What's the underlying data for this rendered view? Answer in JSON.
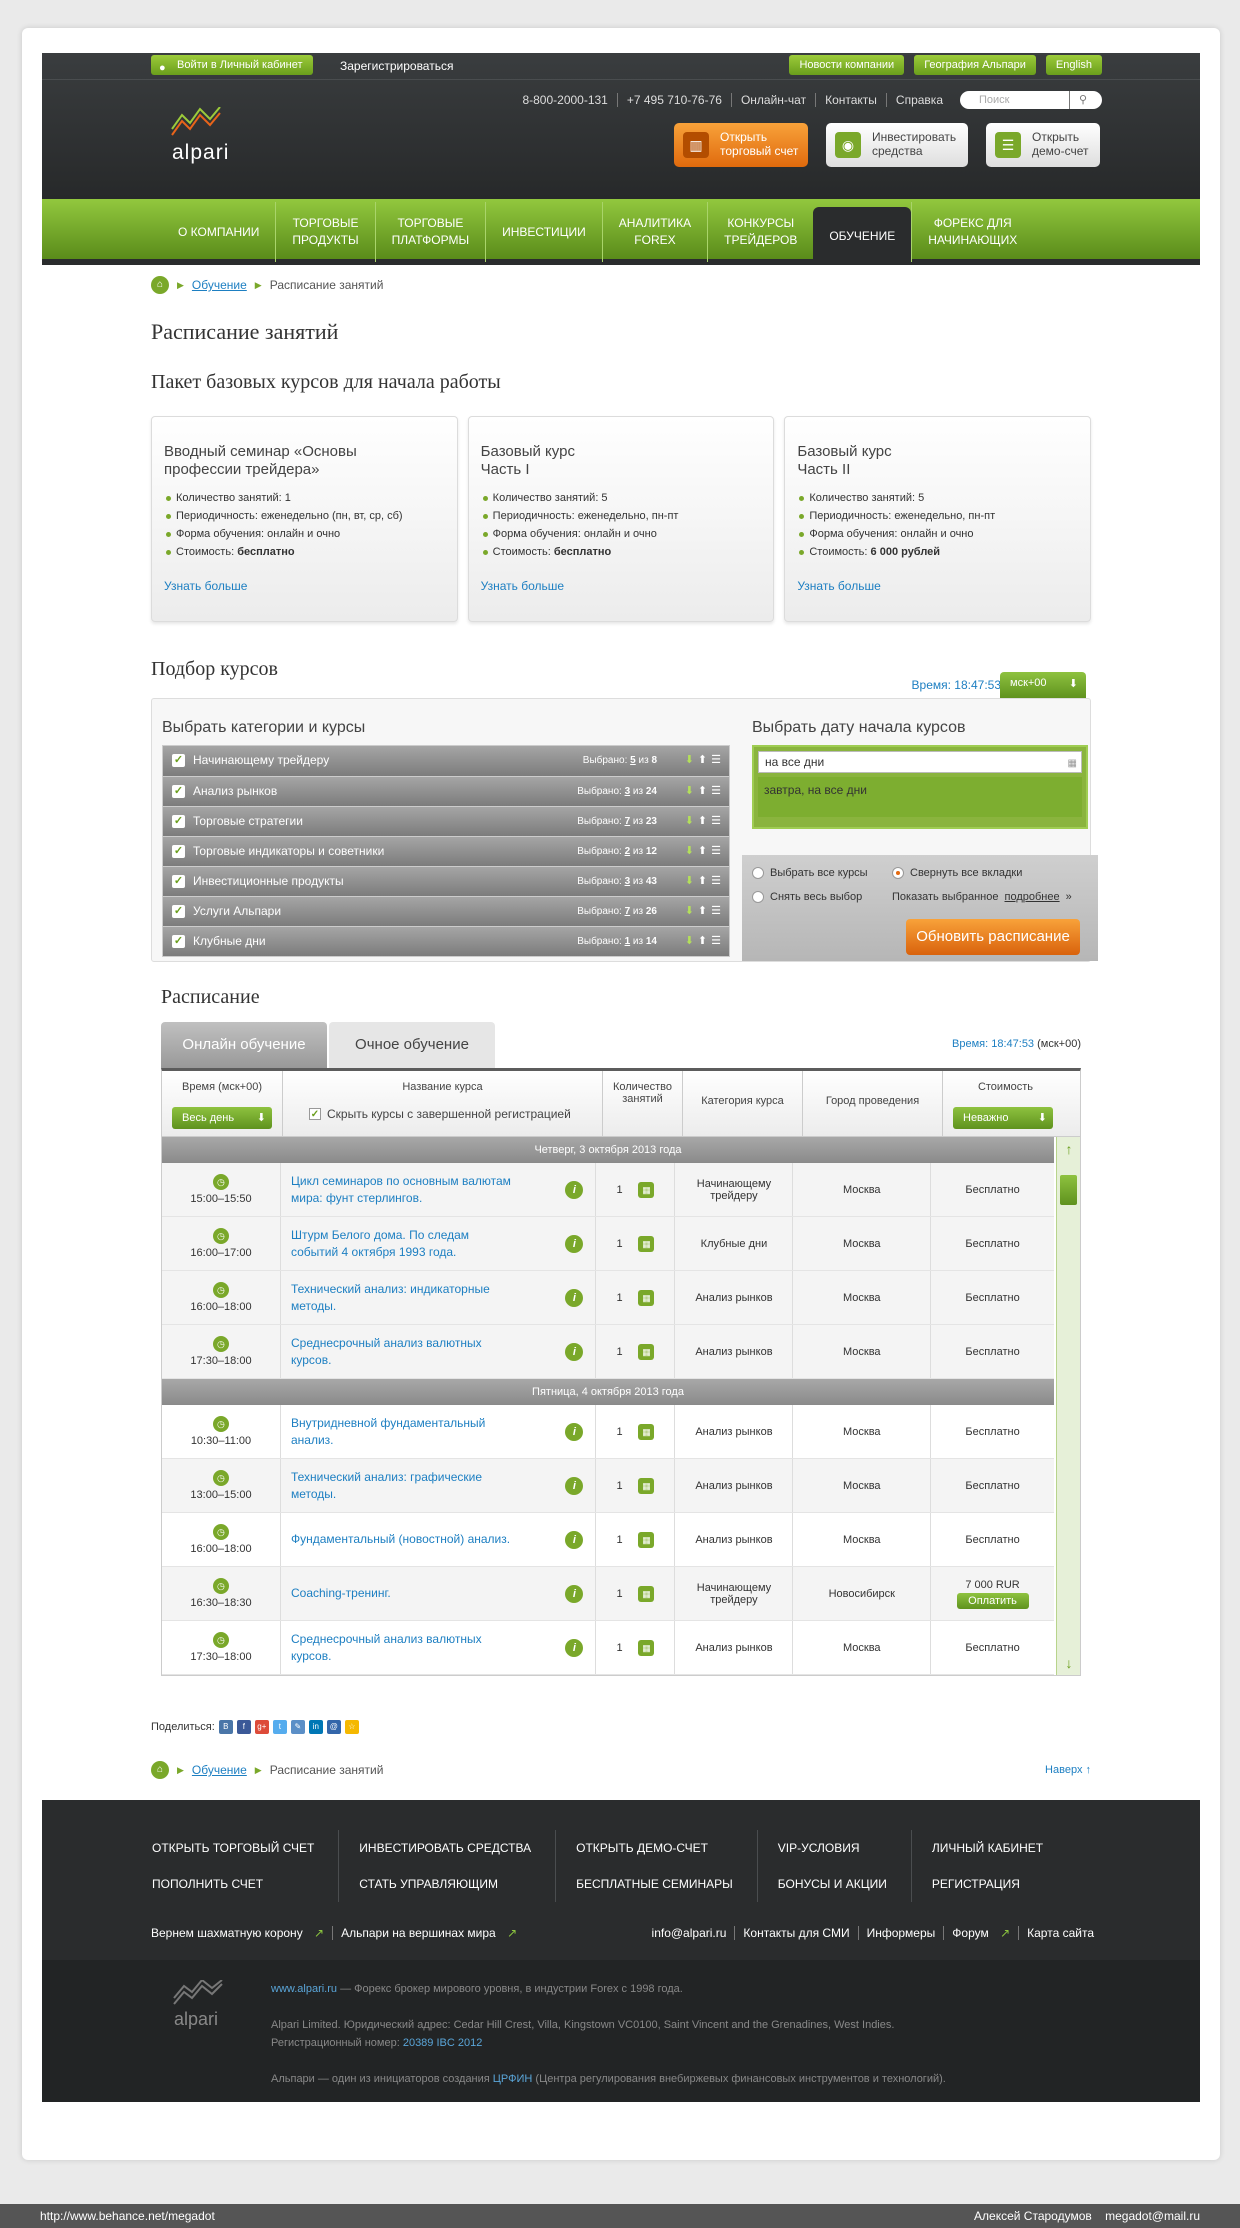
{
  "header": {
    "login": "Войти в Личный кабинет",
    "register": "Зарегистрироваться",
    "top_links": [
      "Новости компании",
      "География Альпари",
      "English"
    ],
    "contacts": [
      "8-800-2000-131",
      "+7 495 710-76-76",
      "Онлайн-чат",
      "Контакты",
      "Справка"
    ],
    "search_placeholder": "Поиск",
    "logo": "alpari",
    "cta": [
      {
        "line1": "Открыть",
        "line2": "торговый счет"
      },
      {
        "line1": "Инвестировать",
        "line2": "средства"
      },
      {
        "line1": "Открыть",
        "line2": "демо-счет"
      }
    ]
  },
  "nav": [
    {
      "l1": "О КОМПАНИИ",
      "l2": ""
    },
    {
      "l1": "ТОРГОВЫЕ",
      "l2": "ПРОДУКТЫ"
    },
    {
      "l1": "ТОРГОВЫЕ",
      "l2": "ПЛАТФОРМЫ"
    },
    {
      "l1": "ИНВЕСТИЦИИ",
      "l2": ""
    },
    {
      "l1": "АНАЛИТИКА",
      "l2": "FOREX"
    },
    {
      "l1": "КОНКУРСЫ",
      "l2": "ТРЕЙДЕРОВ"
    },
    {
      "l1": "ОБУЧЕНИЕ",
      "l2": ""
    },
    {
      "l1": "ФОРЕКС ДЛЯ",
      "l2": "НАЧИНАЮЩИХ"
    }
  ],
  "breadcrumb": {
    "link": "Обучение",
    "current": "Расписание занятий"
  },
  "page_title": "Расписание занятий",
  "package_title": "Пакет базовых курсов для начала работы",
  "cards": [
    {
      "t1": "Вводный семинар «Основы",
      "t2": "профессии трейдера»",
      "count": "Количество занятий: 1",
      "period": "Периодичность: еженедельно (пн, вт, ср, сб)",
      "form": "Форма обучения: онлайн и очно",
      "price_label": "Стоимость: ",
      "price": "бесплатно",
      "more": "Узнать больше"
    },
    {
      "t1": "Базовый курс",
      "t2": "Часть I",
      "count": "Количество занятий: 5",
      "period": "Периодичность: еженедельно, пн-пт",
      "form": "Форма обучения: онлайн и очно",
      "price_label": "Стоимость: ",
      "price": "бесплатно",
      "more": "Узнать больше"
    },
    {
      "t1": "Базовый курс",
      "t2": "Часть II",
      "count": "Количество занятий: 5",
      "period": "Периодичность: еженедельно, пн-пт",
      "form": "Форма обучения: онлайн и очно",
      "price_label": "Стоимость: ",
      "price": "6 000 рублей",
      "more": "Узнать больше"
    }
  ],
  "filter": {
    "title": "Подбор курсов",
    "time": "Время: 18:47:53",
    "tz": "мск+00",
    "cats_title": "Выбрать категории и курсы",
    "categories": [
      {
        "name": "Начинающему трейдеру",
        "sel": "5",
        "total": "8"
      },
      {
        "name": "Анализ рынков",
        "sel": "3",
        "total": "24"
      },
      {
        "name": "Торговые стратегии",
        "sel": "7",
        "total": "23"
      },
      {
        "name": "Торговые индикаторы и советники",
        "sel": "2",
        "total": "12"
      },
      {
        "name": "Инвестиционные продукты",
        "sel": "3",
        "total": "43"
      },
      {
        "name": "Услуги Альпари",
        "sel": "7",
        "total": "26"
      },
      {
        "name": "Клубные дни",
        "sel": "1",
        "total": "14"
      }
    ],
    "selected_label": "Выбрано:",
    "of_label": "из",
    "date_title": "Выбрать дату начала курсов",
    "date_value": "на все дни",
    "date_selected": "завтра, на все дни",
    "opt_all": "Выбрать все курсы",
    "opt_none": "Снять весь выбор",
    "opt_collapse": "Свернуть все вкладки",
    "opt_show": "Показать выбранное",
    "opt_more": "подробнее",
    "update": "Обновить расписание"
  },
  "schedule": {
    "title": "Расписание",
    "tab_online": "Онлайн обучение",
    "tab_offline": "Очное обучение",
    "time": "Время: 18:47:53",
    "tz": "(мск+00)",
    "h_time": "Время (мск+00)",
    "h_name": "Название курса",
    "h_hide": "Скрыть курсы с завершенной регистрацией",
    "h_count_1": "Количество",
    "h_count_2": "занятий",
    "h_cat": "Категория курса",
    "h_city": "Город проведения",
    "h_price": "Стоимость",
    "btn_days": "Весь день",
    "btn_price": "Неважно",
    "days": [
      {
        "label": "Четверг, 3 октября 2013 года",
        "rows": [
          {
            "time": "15:00–15:50",
            "n1": "Цикл семинаров по основным валютам",
            "n2": "мира: фунт стерлингов.",
            "count": "1",
            "cat1": "Начинающему",
            "cat2": "трейдеру",
            "city": "Москва",
            "price": "Бесплатно"
          },
          {
            "time": "16:00–17:00",
            "n1": "Штурм Белого дома. По следам",
            "n2": "событий 4 октября 1993 года.",
            "count": "1",
            "cat1": "Клубные дни",
            "cat2": "",
            "city": "Москва",
            "price": "Бесплатно"
          },
          {
            "time": "16:00–18:00",
            "n1": "Технический анализ: индикаторные",
            "n2": "методы.",
            "count": "1",
            "cat1": "Анализ рынков",
            "cat2": "",
            "city": "Москва",
            "price": "Бесплатно"
          },
          {
            "time": "17:30–18:00",
            "n1": "Среднесрочный анализ валютных",
            "n2": "курсов.",
            "count": "1",
            "cat1": "Анализ рынков",
            "cat2": "",
            "city": "Москва",
            "price": "Бесплатно"
          }
        ]
      },
      {
        "label": "Пятница, 4 октября 2013 года",
        "rows": [
          {
            "time": "10:30–11:00",
            "n1": "Внутридневной фундаментальный",
            "n2": "анализ.",
            "count": "1",
            "cat1": "Анализ рынков",
            "cat2": "",
            "city": "Москва",
            "price": "Бесплатно"
          },
          {
            "time": "13:00–15:00",
            "n1": "Технический анализ: графические",
            "n2": "методы.",
            "count": "1",
            "cat1": "Анализ рынков",
            "cat2": "",
            "city": "Москва",
            "price": "Бесплатно"
          },
          {
            "time": "16:00–18:00",
            "n1": "Фундаментальный (новостной) анализ.",
            "n2": "",
            "count": "1",
            "cat1": "Анализ рынков",
            "cat2": "",
            "city": "Москва",
            "price": "Бесплатно"
          },
          {
            "time": "16:30–18:30",
            "n1": "Coaching-тренинг.",
            "n2": "",
            "count": "1",
            "cat1": "Начинающему",
            "cat2": "трейдеру",
            "city": "Новосибирск",
            "price": "7 000 RUR",
            "pay": "Оплатить"
          },
          {
            "time": "17:30–18:00",
            "n1": "Среднесрочный анализ валютных",
            "n2": "курсов.",
            "count": "1",
            "cat1": "Анализ рынков",
            "cat2": "",
            "city": "Москва",
            "price": "Бесплатно"
          }
        ]
      }
    ]
  },
  "share": {
    "label": "Поделиться:",
    "icons": [
      "В",
      "f",
      "g+",
      "t",
      "✎",
      "in",
      "@",
      "☆"
    ]
  },
  "top_link": "Наверх ↑",
  "footer": {
    "cols": [
      [
        "ОТКРЫТЬ ТОРГОВЫЙ СЧЕТ",
        "ПОПОЛНИТЬ СЧЕТ"
      ],
      [
        "ИНВЕСТИРОВАТЬ СРЕДСТВА",
        "СТАТЬ УПРАВЛЯЮЩИМ"
      ],
      [
        "ОТКРЫТЬ ДЕМО-СЧЕТ",
        "БЕСПЛАТНЫЕ СЕМИНАРЫ"
      ],
      [
        "VIP-УСЛОВИЯ",
        "БОНУСЫ И АКЦИИ"
      ],
      [
        "ЛИЧНЫЙ КАБИНЕТ",
        "РЕГИСТРАЦИЯ"
      ]
    ],
    "sub_left": [
      "Вернем шахматную корону",
      "Альпари на вершинах мира"
    ],
    "sub_right": [
      "info@alpari.ru",
      "Контакты для СМИ",
      "Информеры",
      "Форум",
      "Карта сайта"
    ],
    "logo": "alpari",
    "l1_link": "www.alpari.ru",
    "l1_text": " — Форекс брокер мирового уровня, в индустрии Forex с 1998 года.",
    "l2": "Alpari Limited. Юридический адрес: Cedar Hill Crest, Villa, Kingstown VC0100, Saint Vincent and the Grenadines, West Indies.",
    "l3_text": "Регистрационный номер: ",
    "l3_link": "20389 IBC 2012",
    "l4_text": "Альпари — один из инициаторов создания ",
    "l4_link": "ЦРФИН",
    "l4_tail": " (Центра регулирования внебиржевых финансовых инструментов и технологий)."
  },
  "bottom_bar": {
    "left": "http://www.behance.net/megadot",
    "author": "Алексей Стародумов",
    "email": "megadot@mail.ru"
  }
}
